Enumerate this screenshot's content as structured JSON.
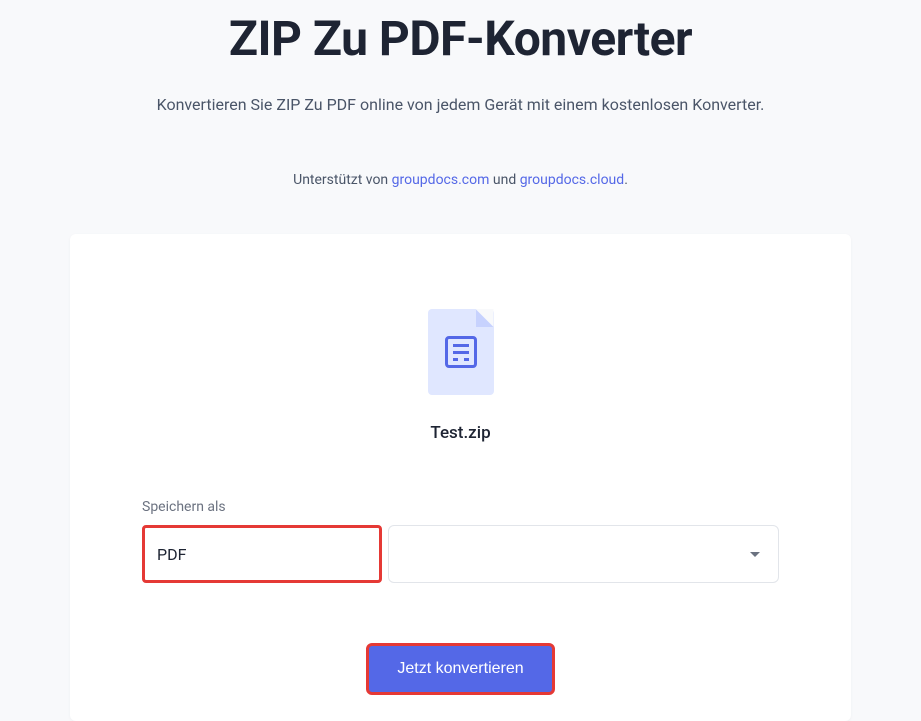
{
  "header": {
    "title": "ZIP Zu PDF-Konverter",
    "subtitle": "Konvertieren Sie ZIP Zu PDF online von jedem Gerät mit einem kostenlosen Konverter.",
    "poweredByPrefix": "Unterstützt von ",
    "poweredByLink1": "groupdocs.com",
    "poweredByMid": " und ",
    "poweredByLink2": "groupdocs.cloud",
    "poweredBySuffix": "."
  },
  "file": {
    "name": "Test.zip"
  },
  "form": {
    "saveAsLabel": "Speichern als",
    "selectedFormat": "PDF",
    "convertButton": "Jetzt konvertieren"
  }
}
